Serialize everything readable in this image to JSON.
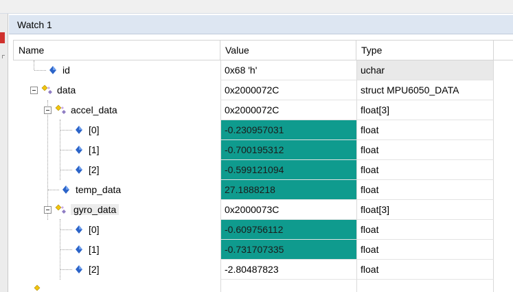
{
  "panel": {
    "title": "Watch 1"
  },
  "columns": {
    "name": "Name",
    "value": "Value",
    "type": "Type"
  },
  "colors": {
    "changed_value_bg": "#0f9b8e",
    "header_bg": "#dde6f2",
    "var_icon": "#2b63c8",
    "struct_icon": "#f1c40f"
  },
  "rows": [
    {
      "name": "id",
      "value": "0x68 'h'",
      "type": "uchar",
      "icon": "variable-icon"
    },
    {
      "name": "data",
      "value": "0x2000072C",
      "type": "struct MPU6050_DATA",
      "icon": "struct-icon",
      "expanded": true
    },
    {
      "name": "accel_data",
      "value": "0x2000072C",
      "type": "float[3]",
      "icon": "struct-icon",
      "expanded": true
    },
    {
      "name": "[0]",
      "value": "-0.230957031",
      "type": "float",
      "icon": "variable-icon",
      "changed": true
    },
    {
      "name": "[1]",
      "value": "-0.700195312",
      "type": "float",
      "icon": "variable-icon",
      "changed": true
    },
    {
      "name": "[2]",
      "value": "-0.599121094",
      "type": "float",
      "icon": "variable-icon",
      "changed": true
    },
    {
      "name": "temp_data",
      "value": "27.1888218",
      "type": "float",
      "icon": "variable-icon",
      "changed": true
    },
    {
      "name": "gyro_data",
      "value": "0x2000073C",
      "type": "float[3]",
      "icon": "struct-icon",
      "expanded": true,
      "selected": true
    },
    {
      "name": "[0]",
      "value": "-0.609756112",
      "type": "float",
      "icon": "variable-icon",
      "changed": true
    },
    {
      "name": "[1]",
      "value": "-0.731707335",
      "type": "float",
      "icon": "variable-icon",
      "changed": true
    },
    {
      "name": "[2]",
      "value": "-2.80487823",
      "type": "float",
      "icon": "variable-icon"
    }
  ]
}
